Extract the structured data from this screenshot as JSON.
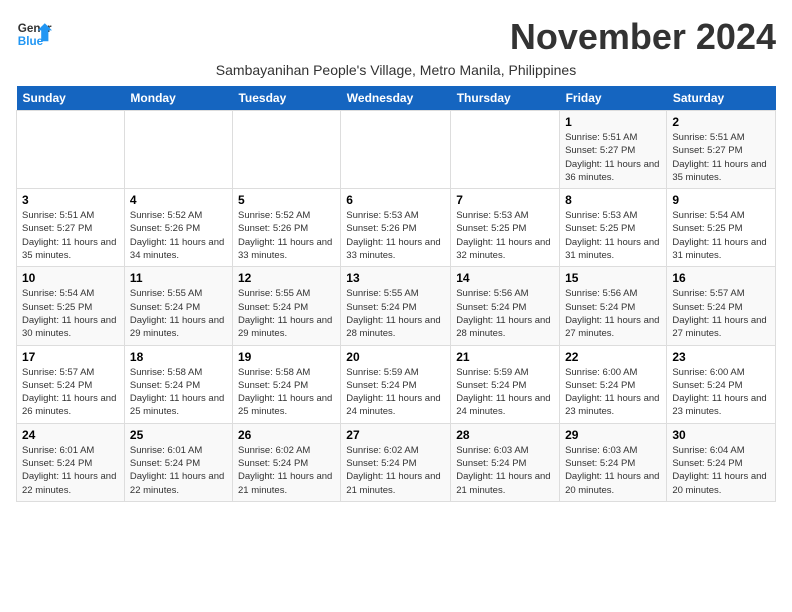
{
  "logo": {
    "line1": "General",
    "line2": "Blue"
  },
  "title": "November 2024",
  "subtitle": "Sambayanihan People's Village, Metro Manila, Philippines",
  "weekdays": [
    "Sunday",
    "Monday",
    "Tuesday",
    "Wednesday",
    "Thursday",
    "Friday",
    "Saturday"
  ],
  "weeks": [
    [
      {
        "day": "",
        "info": ""
      },
      {
        "day": "",
        "info": ""
      },
      {
        "day": "",
        "info": ""
      },
      {
        "day": "",
        "info": ""
      },
      {
        "day": "",
        "info": ""
      },
      {
        "day": "1",
        "info": "Sunrise: 5:51 AM\nSunset: 5:27 PM\nDaylight: 11 hours and 36 minutes."
      },
      {
        "day": "2",
        "info": "Sunrise: 5:51 AM\nSunset: 5:27 PM\nDaylight: 11 hours and 35 minutes."
      }
    ],
    [
      {
        "day": "3",
        "info": "Sunrise: 5:51 AM\nSunset: 5:27 PM\nDaylight: 11 hours and 35 minutes."
      },
      {
        "day": "4",
        "info": "Sunrise: 5:52 AM\nSunset: 5:26 PM\nDaylight: 11 hours and 34 minutes."
      },
      {
        "day": "5",
        "info": "Sunrise: 5:52 AM\nSunset: 5:26 PM\nDaylight: 11 hours and 33 minutes."
      },
      {
        "day": "6",
        "info": "Sunrise: 5:53 AM\nSunset: 5:26 PM\nDaylight: 11 hours and 33 minutes."
      },
      {
        "day": "7",
        "info": "Sunrise: 5:53 AM\nSunset: 5:25 PM\nDaylight: 11 hours and 32 minutes."
      },
      {
        "day": "8",
        "info": "Sunrise: 5:53 AM\nSunset: 5:25 PM\nDaylight: 11 hours and 31 minutes."
      },
      {
        "day": "9",
        "info": "Sunrise: 5:54 AM\nSunset: 5:25 PM\nDaylight: 11 hours and 31 minutes."
      }
    ],
    [
      {
        "day": "10",
        "info": "Sunrise: 5:54 AM\nSunset: 5:25 PM\nDaylight: 11 hours and 30 minutes."
      },
      {
        "day": "11",
        "info": "Sunrise: 5:55 AM\nSunset: 5:24 PM\nDaylight: 11 hours and 29 minutes."
      },
      {
        "day": "12",
        "info": "Sunrise: 5:55 AM\nSunset: 5:24 PM\nDaylight: 11 hours and 29 minutes."
      },
      {
        "day": "13",
        "info": "Sunrise: 5:55 AM\nSunset: 5:24 PM\nDaylight: 11 hours and 28 minutes."
      },
      {
        "day": "14",
        "info": "Sunrise: 5:56 AM\nSunset: 5:24 PM\nDaylight: 11 hours and 28 minutes."
      },
      {
        "day": "15",
        "info": "Sunrise: 5:56 AM\nSunset: 5:24 PM\nDaylight: 11 hours and 27 minutes."
      },
      {
        "day": "16",
        "info": "Sunrise: 5:57 AM\nSunset: 5:24 PM\nDaylight: 11 hours and 27 minutes."
      }
    ],
    [
      {
        "day": "17",
        "info": "Sunrise: 5:57 AM\nSunset: 5:24 PM\nDaylight: 11 hours and 26 minutes."
      },
      {
        "day": "18",
        "info": "Sunrise: 5:58 AM\nSunset: 5:24 PM\nDaylight: 11 hours and 25 minutes."
      },
      {
        "day": "19",
        "info": "Sunrise: 5:58 AM\nSunset: 5:24 PM\nDaylight: 11 hours and 25 minutes."
      },
      {
        "day": "20",
        "info": "Sunrise: 5:59 AM\nSunset: 5:24 PM\nDaylight: 11 hours and 24 minutes."
      },
      {
        "day": "21",
        "info": "Sunrise: 5:59 AM\nSunset: 5:24 PM\nDaylight: 11 hours and 24 minutes."
      },
      {
        "day": "22",
        "info": "Sunrise: 6:00 AM\nSunset: 5:24 PM\nDaylight: 11 hours and 23 minutes."
      },
      {
        "day": "23",
        "info": "Sunrise: 6:00 AM\nSunset: 5:24 PM\nDaylight: 11 hours and 23 minutes."
      }
    ],
    [
      {
        "day": "24",
        "info": "Sunrise: 6:01 AM\nSunset: 5:24 PM\nDaylight: 11 hours and 22 minutes."
      },
      {
        "day": "25",
        "info": "Sunrise: 6:01 AM\nSunset: 5:24 PM\nDaylight: 11 hours and 22 minutes."
      },
      {
        "day": "26",
        "info": "Sunrise: 6:02 AM\nSunset: 5:24 PM\nDaylight: 11 hours and 21 minutes."
      },
      {
        "day": "27",
        "info": "Sunrise: 6:02 AM\nSunset: 5:24 PM\nDaylight: 11 hours and 21 minutes."
      },
      {
        "day": "28",
        "info": "Sunrise: 6:03 AM\nSunset: 5:24 PM\nDaylight: 11 hours and 21 minutes."
      },
      {
        "day": "29",
        "info": "Sunrise: 6:03 AM\nSunset: 5:24 PM\nDaylight: 11 hours and 20 minutes."
      },
      {
        "day": "30",
        "info": "Sunrise: 6:04 AM\nSunset: 5:24 PM\nDaylight: 11 hours and 20 minutes."
      }
    ]
  ]
}
